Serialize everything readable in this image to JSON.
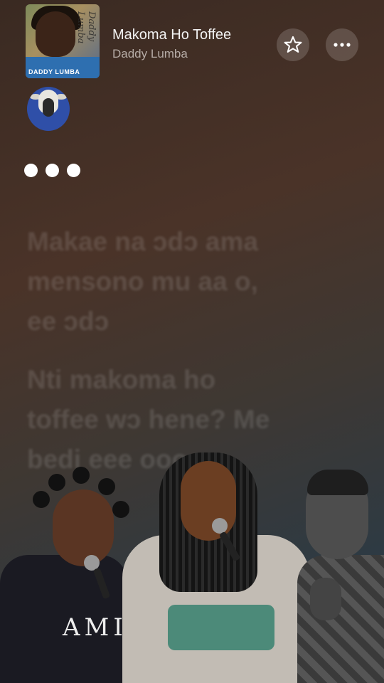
{
  "player": {
    "title": "Makoma Ho Toffee",
    "artist": "Daddy Lumba",
    "album_label": "DADDY LUMBA",
    "album_script": "Daddy Lumba",
    "favorite_icon": "star-icon",
    "more_icon": "ellipsis-icon"
  },
  "lyrics": {
    "loading_indicator": "three-dots",
    "stanza1": [
      "Makae na ɔdɔ ama",
      "mensono mu aa o,",
      "ee ɔdɔ"
    ],
    "stanza2": [
      "Nti makoma ho",
      "toffee wɔ hene? Me",
      "bedi eee ooo"
    ]
  },
  "overlay": {
    "shirt_text": "AMIRI"
  }
}
